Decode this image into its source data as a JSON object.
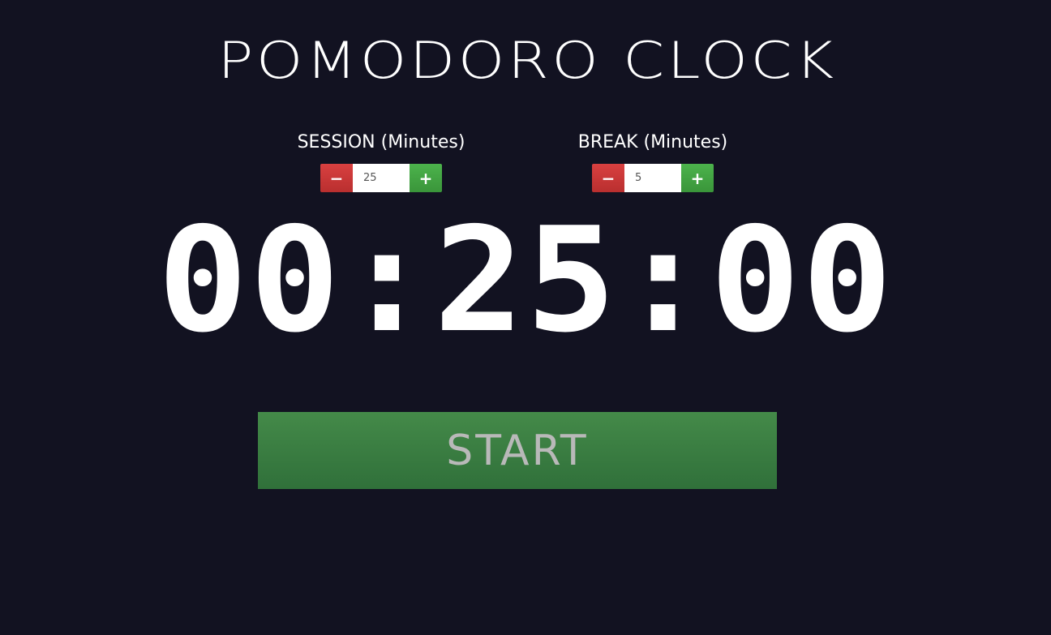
{
  "title": "POMODORO CLOCK",
  "session": {
    "label": "SESSION (Minutes)",
    "value": "25",
    "decrement": "−",
    "increment": "+"
  },
  "break": {
    "label": "BREAK (Minutes)",
    "value": "5",
    "decrement": "−",
    "increment": "+"
  },
  "timer": "00:25:00",
  "start_label": "START",
  "colors": {
    "background": "#121221",
    "minus": "#c83535",
    "plus": "#43a543",
    "start": "#3a7d42",
    "start_text": "#b9b9b9"
  }
}
